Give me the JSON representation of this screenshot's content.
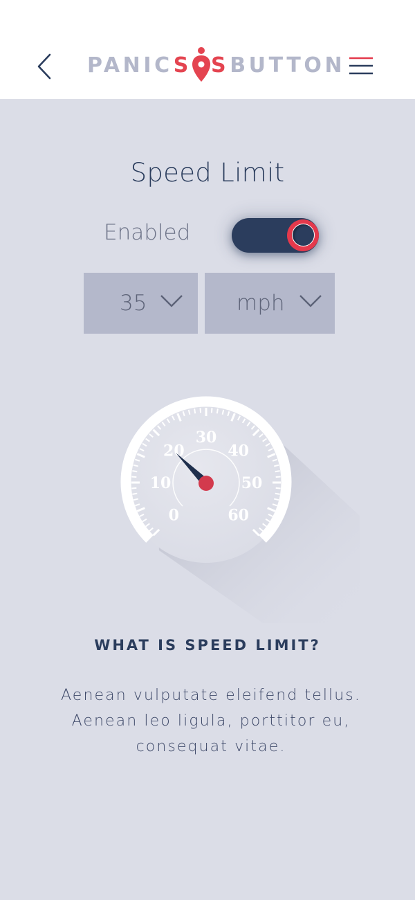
{
  "header": {
    "back_icon": "chevron-left-icon",
    "menu_icon": "hamburger-menu-icon",
    "logo": {
      "part1": "PANIC",
      "part2_s1": "S",
      "part2_s2": "S",
      "part3": "BUTTON",
      "pin_icon": "location-pin-icon"
    }
  },
  "page": {
    "title": "Speed Limit"
  },
  "toggle": {
    "label": "Enabled",
    "state": "on"
  },
  "speed_select": {
    "value": "35",
    "chevron_icon": "chevron-down-icon"
  },
  "unit_select": {
    "value": "mph",
    "chevron_icon": "chevron-down-icon"
  },
  "gauge": {
    "labels": [
      "0",
      "10",
      "20",
      "30",
      "40",
      "50",
      "60"
    ],
    "needle_value": 20,
    "min": 0,
    "max": 60
  },
  "info": {
    "heading": "WHAT IS SPEED LIMIT?",
    "body": "Aenean vulputate eleifend tellus. Aenean leo ligula, porttitor eu, consequat vitae."
  },
  "colors": {
    "background": "#dbdde7",
    "header": "#ffffff",
    "navy": "#2b3d5d",
    "accent_red": "#e4394c",
    "select_bg": "#b4b8cb"
  }
}
